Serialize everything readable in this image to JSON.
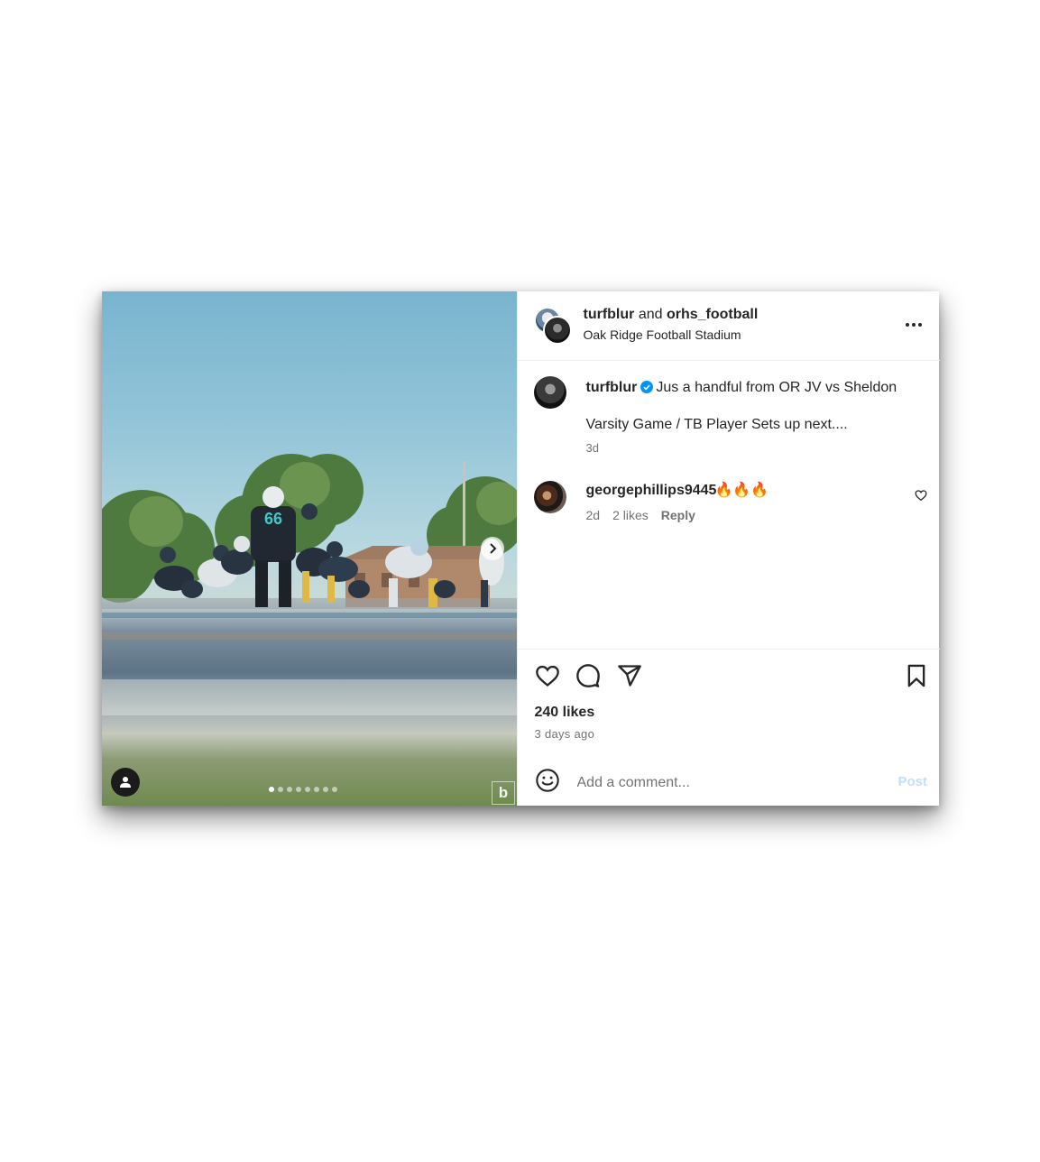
{
  "post_header": {
    "user1": "turfblur",
    "joiner": "and",
    "user2": "orhs_football",
    "location": "Oak Ridge Football Stadium"
  },
  "caption": {
    "username": "turfblur",
    "text_line1": "Jus a handful from OR JV vs Sheldon",
    "text_line2": "Varsity Game / TB Player Sets up next....",
    "time": "3d"
  },
  "comment": {
    "username": "georgephillips9445",
    "text": "🔥🔥🔥",
    "time": "2d",
    "likes": "2 likes",
    "reply_label": "Reply"
  },
  "media": {
    "carousel_count": 8,
    "active_index": 0,
    "jersey_number": "66",
    "watermark": "b"
  },
  "footer": {
    "likes": "240 likes",
    "posted": "3 days ago",
    "comment_placeholder": "Add a comment...",
    "post_label": "Post"
  },
  "icons": {
    "like": "heart-icon",
    "comment": "comment-bubble-icon",
    "share": "paper-plane-icon",
    "save": "bookmark-icon",
    "more": "more-dots-icon",
    "emoji": "smiley-icon",
    "verified": "verified-badge-icon"
  },
  "colors": {
    "verified": "#0095f6",
    "post_disabled": "#c0dffd",
    "secondary_text": "#737373",
    "jersey_teal": "#3fc9c9"
  }
}
